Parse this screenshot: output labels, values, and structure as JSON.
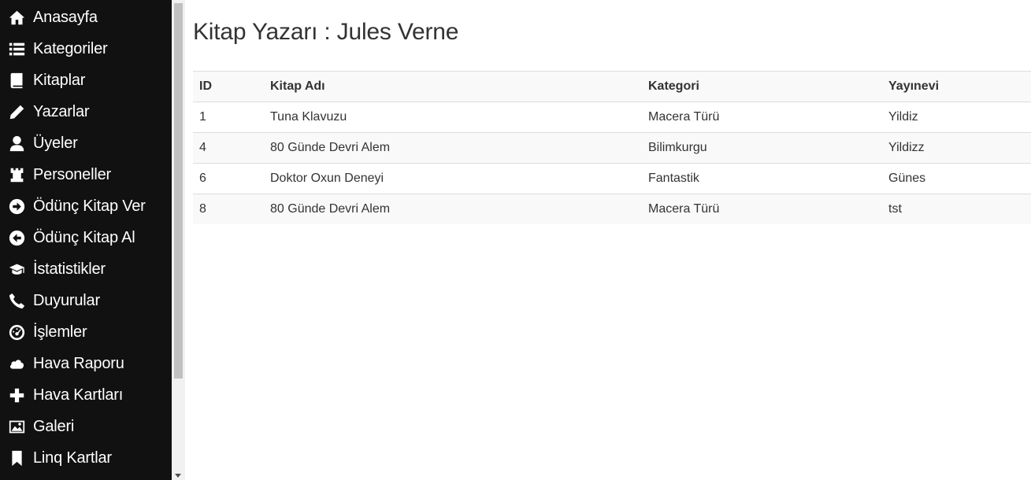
{
  "sidebar": {
    "items": [
      {
        "label": "Anasayfa",
        "icon": "home-icon"
      },
      {
        "label": "Kategoriler",
        "icon": "list-icon"
      },
      {
        "label": "Kitaplar",
        "icon": "book-icon"
      },
      {
        "label": "Yazarlar",
        "icon": "pencil-icon"
      },
      {
        "label": "Üyeler",
        "icon": "user-icon"
      },
      {
        "label": "Personeller",
        "icon": "tower-icon"
      },
      {
        "label": "Ödünç Kitap Ver",
        "icon": "circle-arrow-right-icon"
      },
      {
        "label": "Ödünç Kitap Al",
        "icon": "circle-arrow-left-icon"
      },
      {
        "label": "İstatistikler",
        "icon": "education-icon"
      },
      {
        "label": "Duyurular",
        "icon": "phone-icon"
      },
      {
        "label": "İşlemler",
        "icon": "dashboard-icon"
      },
      {
        "label": "Hava Raporu",
        "icon": "cloud-icon"
      },
      {
        "label": "Hava Kartları",
        "icon": "plus-icon"
      },
      {
        "label": "Galeri",
        "icon": "picture-icon"
      },
      {
        "label": "Linq Kartlar",
        "icon": "bookmark-icon"
      }
    ]
  },
  "main": {
    "title": "Kitap Yazarı : Jules Verne",
    "table": {
      "headers": [
        "ID",
        "Kitap Adı",
        "Kategori",
        "Yayınevi"
      ],
      "rows": [
        [
          "1",
          "Tuna Klavuzu",
          "Macera Türü",
          "Yildiz"
        ],
        [
          "4",
          "80 Günde Devri Alem",
          "Bilimkurgu",
          "Yildizz"
        ],
        [
          "6",
          "Doktor Oxun Deneyi",
          "Fantastik",
          "Günes"
        ],
        [
          "8",
          "80 Günde Devri Alem",
          "Macera Türü",
          "tst"
        ]
      ]
    }
  }
}
